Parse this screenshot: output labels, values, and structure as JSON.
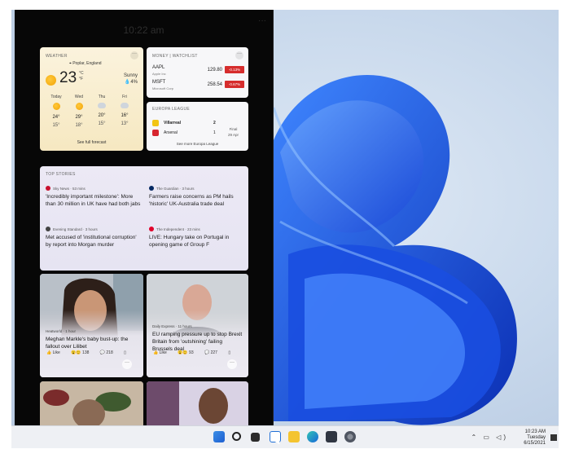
{
  "widgets_panel": {
    "clock": "10:22 am",
    "weather": {
      "header": "WEATHER",
      "location": "Poplar, England",
      "temperature": "23",
      "units_c": "°C",
      "units_f": "°F",
      "condition": "Sunny",
      "precip": "4%",
      "forecast": [
        {
          "day": "Today",
          "icon": "sun-icon",
          "high": "24°",
          "low": "15°"
        },
        {
          "day": "Wed",
          "icon": "sun-icon",
          "high": "29°",
          "low": "18°"
        },
        {
          "day": "Thu",
          "icon": "cloud-icon",
          "high": "20°",
          "low": "15°"
        },
        {
          "day": "Fri",
          "icon": "cloud-icon",
          "high": "16°",
          "low": "13°"
        }
      ],
      "link": "See full forecast"
    },
    "money": {
      "header": "MONEY | WATCHLIST",
      "stocks": [
        {
          "symbol": "AAPL",
          "name": "Apple Inc",
          "price": "129.80",
          "change": "-0.13%"
        },
        {
          "symbol": "MSFT",
          "name": "Microsoft Corp",
          "price": "258.54",
          "change": "-0.67%"
        }
      ]
    },
    "europa": {
      "header": "EUROPA LEAGUE",
      "home": {
        "team": "Villarreal",
        "score": "2"
      },
      "away": {
        "team": "Arsenal",
        "score": "1"
      },
      "status": "Final",
      "date": "29 Apr",
      "link": "See more Europa League"
    },
    "top_stories": {
      "header": "TOP STORIES",
      "items": [
        {
          "source": "Sky News · 53 mins",
          "headline": "'Incredibly important milestone': More than 30 million in UK have had both jabs"
        },
        {
          "source": "The Guardian · 3 hours",
          "headline": "Farmers raise concerns as PM hails 'historic' UK-Australia trade deal"
        },
        {
          "source": "Evening Standard · 3 hours",
          "headline": "Met accused of 'institutional corruption' by report into Morgan murder"
        },
        {
          "source": "The Independent · 23 mins",
          "headline": "LIVE: Hungary take on Portugal in opening game of Group F"
        }
      ]
    },
    "tiles": [
      {
        "source": "Heatworld · 1 hour",
        "headline": "Meghan Markle's baby bust-up: the fallout over Lilibet",
        "like": "Like",
        "reactions": "138",
        "comments": "218"
      },
      {
        "source": "Daily Express · 11 hours",
        "headline": "EU ramping pressure up to stop Brexit Britain from 'outshining' failing Brussels deal",
        "like": "Like",
        "reactions": "93",
        "comments": "227"
      }
    ]
  },
  "taskbar": {
    "time": "10:23 AM",
    "weekday": "Tuesday",
    "date": "6/15/2021"
  },
  "colors": {
    "accent_blue": "#1f5fe0",
    "stock_down": "#d62d2d"
  }
}
